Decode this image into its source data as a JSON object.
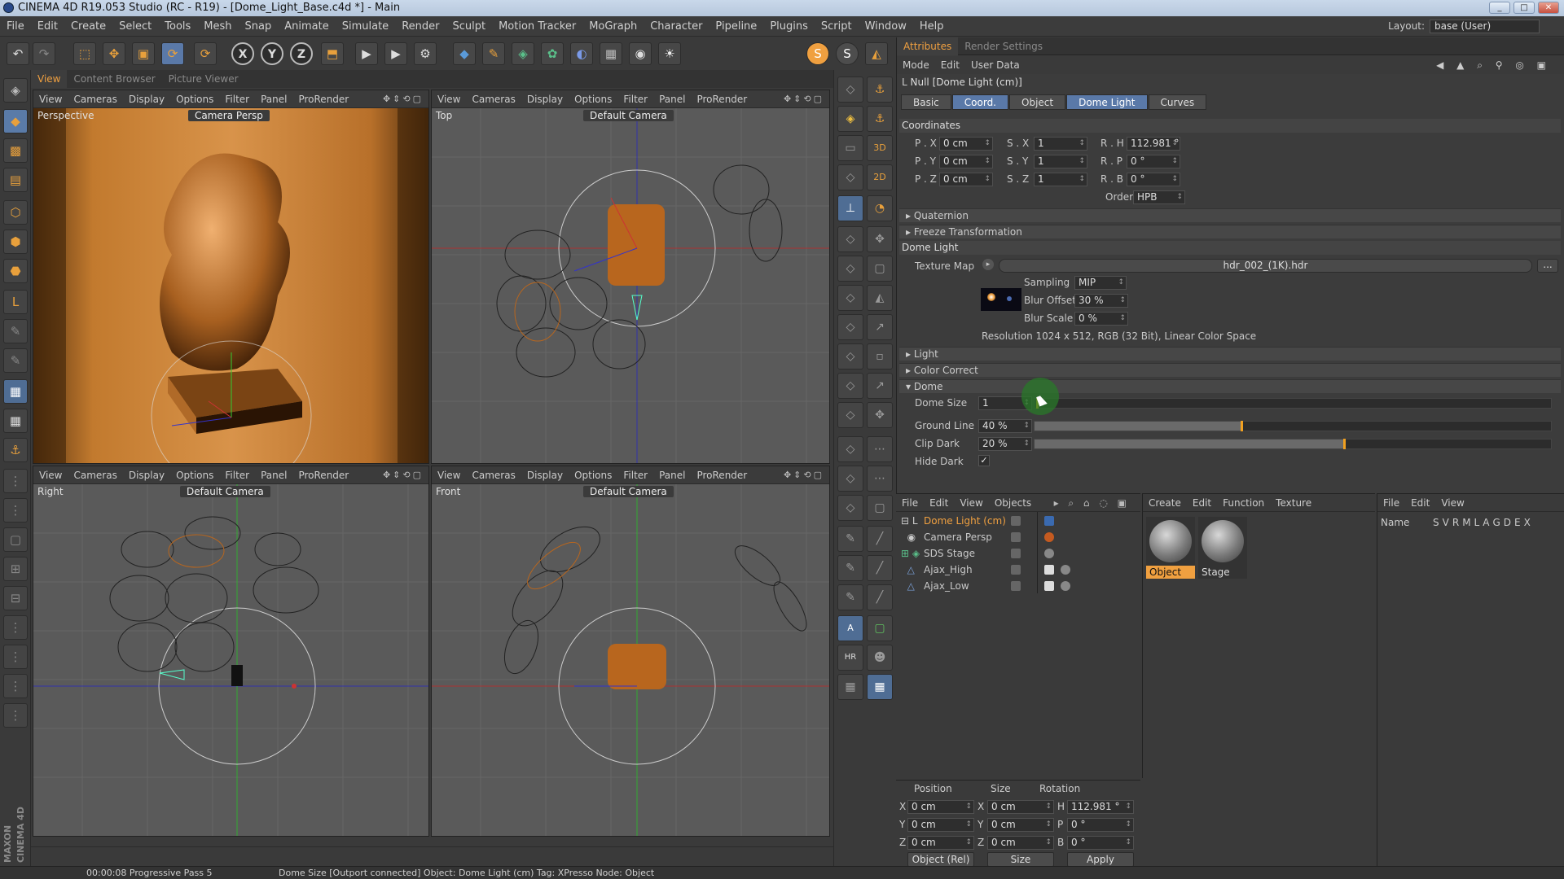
{
  "window": {
    "title": "CINEMA 4D R19.053 Studio (RC - R19) - [Dome_Light_Base.c4d *] - Main"
  },
  "menu": [
    "File",
    "Edit",
    "Create",
    "Select",
    "Tools",
    "Mesh",
    "Snap",
    "Animate",
    "Simulate",
    "Render",
    "Sculpt",
    "Motion Tracker",
    "MoGraph",
    "Character",
    "Pipeline",
    "Plugins",
    "Script",
    "Window",
    "Help"
  ],
  "layout": {
    "label": "Layout:",
    "value": "base (User)"
  },
  "view_tabs": [
    "View",
    "Content Browser",
    "Picture Viewer"
  ],
  "viewport_menu": [
    "View",
    "Cameras",
    "Display",
    "Options",
    "Filter",
    "Panel",
    "ProRender"
  ],
  "viewports": [
    {
      "name": "Perspective",
      "camera": "Camera Persp"
    },
    {
      "name": "Top",
      "camera": "Default Camera"
    },
    {
      "name": "Right",
      "camera": "Default Camera"
    },
    {
      "name": "Front",
      "camera": "Default Camera"
    }
  ],
  "branding": "MAXON CINEMA 4D",
  "attributes": {
    "tabs": [
      "Attributes",
      "Render Settings"
    ],
    "menu": [
      "Mode",
      "Edit",
      "User Data"
    ],
    "object_title": "Null [Dome Light (cm)]",
    "subtabs": [
      "Basic",
      "Coord.",
      "Object",
      "Dome Light",
      "Curves"
    ],
    "coordinates_header": "Coordinates",
    "pos": [
      {
        "label": "P . X",
        "value": "0 cm"
      },
      {
        "label": "P . Y",
        "value": "0 cm"
      },
      {
        "label": "P . Z",
        "value": "0 cm"
      }
    ],
    "scale": [
      {
        "label": "S . X",
        "value": "1"
      },
      {
        "label": "S . Y",
        "value": "1"
      },
      {
        "label": "S . Z",
        "value": "1"
      }
    ],
    "rot": [
      {
        "label": "R . H",
        "value": "112.981 °"
      },
      {
        "label": "R . P",
        "value": "0 °"
      },
      {
        "label": "R . B",
        "value": "0 °"
      }
    ],
    "order_label": "Order",
    "order_value": "HPB",
    "quaternion": "Quaternion",
    "freeze": "Freeze Transformation",
    "dome_light_header": "Dome Light",
    "texture_map_label": "Texture Map",
    "texture_map_value": "hdr_002_(1K).hdr",
    "browse": "...",
    "sampling_label": "Sampling",
    "sampling_value": "MIP",
    "blur_offset_label": "Blur Offset",
    "blur_offset_value": "30 %",
    "blur_scale_label": "Blur Scale",
    "blur_scale_value": "0 %",
    "resolution": "Resolution 1024 x 512, RGB (32 Bit), Linear Color Space",
    "light_group": "Light",
    "color_correct_group": "Color Correct",
    "dome_group": "Dome",
    "dome_size_label": "Dome Size",
    "dome_size_value": "1",
    "ground_line_label": "Ground Line",
    "ground_line_value": "40 %",
    "ground_line_fraction": 0.4,
    "clip_dark_label": "Clip Dark",
    "clip_dark_value": "20 %",
    "clip_dark_fraction": 0.6,
    "hide_dark_label": "Hide Dark",
    "hide_dark_value": "✓",
    "accent": "#f0a040"
  },
  "objects": {
    "menu": [
      "File",
      "Edit",
      "View",
      "Objects"
    ],
    "items": [
      {
        "name": "Dome Light (cm)",
        "color": "#f0a040"
      },
      {
        "name": "Camera Persp",
        "color": "#c8c8c8"
      },
      {
        "name": "SDS Stage",
        "color": "#c8c8c8"
      },
      {
        "name": "Ajax_High",
        "color": "#c8c8c8"
      },
      {
        "name": "Ajax_Low",
        "color": "#c8c8c8"
      }
    ]
  },
  "materials": {
    "menu": [
      "Create",
      "Edit",
      "Function",
      "Texture"
    ],
    "items": [
      "Object",
      "Stage"
    ]
  },
  "layers": {
    "menu": [
      "File",
      "Edit",
      "View"
    ],
    "name_header": "Name",
    "columns": [
      "S",
      "V",
      "R",
      "M",
      "L",
      "A",
      "G",
      "D",
      "E",
      "X"
    ]
  },
  "coords": {
    "headers": [
      "Position",
      "Size",
      "Rotation"
    ],
    "rows": [
      {
        "axis": "X",
        "pos": "0 cm",
        "size_axis": "X",
        "size": "0 cm",
        "rot_axis": "H",
        "rot": "112.981 °"
      },
      {
        "axis": "Y",
        "pos": "0 cm",
        "size_axis": "Y",
        "size": "0 cm",
        "rot_axis": "P",
        "rot": "0 °"
      },
      {
        "axis": "Z",
        "pos": "0 cm",
        "size_axis": "Z",
        "size": "0 cm",
        "rot_axis": "B",
        "rot": "0 °"
      }
    ],
    "mode": "Object (Rel)",
    "size_mode": "Size",
    "apply": "Apply"
  },
  "status": {
    "time": "00:00:08 Progressive Pass 5",
    "message": "Dome Size [Outport connected] Object: Dome Light (cm) Tag: XPresso Node: Object"
  }
}
